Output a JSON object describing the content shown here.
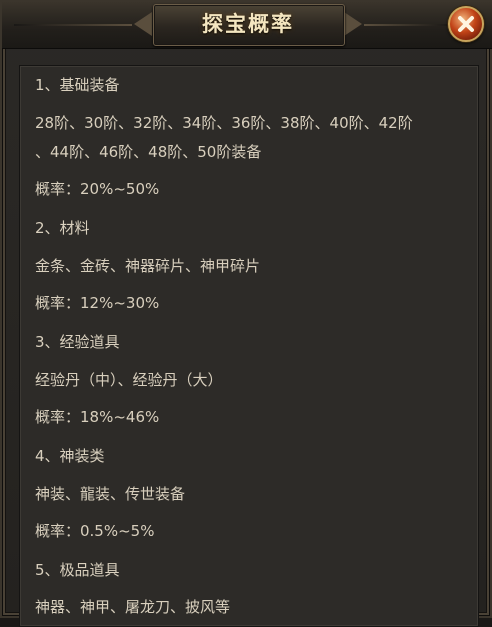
{
  "dialog": {
    "title": "探宝概率"
  },
  "lines": [
    "1、基础装备",
    "28阶、30阶、32阶、34阶、36阶、38阶、40阶、42阶",
    "、44阶、46阶、48阶、50阶装备",
    "概率：20%~50%",
    "2、材料",
    "金条、金砖、神器碎片、神甲碎片",
    "概率：12%~30%",
    "3、经验道具",
    "经验丹（中）、经验丹（大）",
    "概率：18%~46%",
    "4、神装类",
    "神装、龍装、传世装备",
    "概率：0.5%~5%",
    "5、极品道具",
    "神器、神甲、屠龙刀、披风等"
  ],
  "colors": {
    "text": "#d8cfbd",
    "title": "#f4e6c0",
    "panel": "#2d2b28",
    "close": "#c24418"
  },
  "icons": {
    "close": "close-x-icon"
  }
}
